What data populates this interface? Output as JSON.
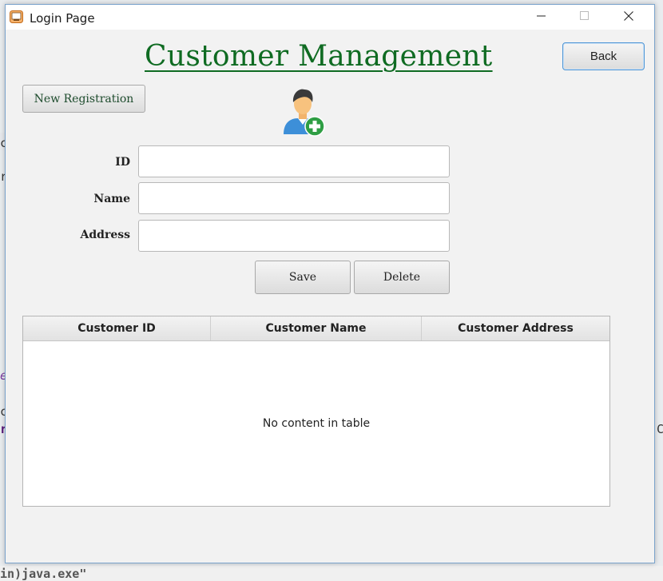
{
  "window": {
    "title": "Login Page",
    "controls": {
      "minimize": "minimize-icon",
      "maximize": "maximize-icon",
      "close": "close-icon"
    }
  },
  "header": {
    "title": "Customer Management",
    "back_label": "Back"
  },
  "new_registration_label": "New Registration",
  "form": {
    "fields": [
      {
        "label": "ID",
        "value": "",
        "placeholder": ""
      },
      {
        "label": "Name",
        "value": "",
        "placeholder": ""
      },
      {
        "label": "Address",
        "value": "",
        "placeholder": ""
      }
    ],
    "save_label": "Save",
    "delete_label": "Delete"
  },
  "table": {
    "columns": [
      "Customer ID",
      "Customer Name",
      "Customer Address"
    ],
    "rows": [],
    "placeholder": "No content in table"
  },
  "background": {
    "fragments": [
      "c",
      "r",
      "e",
      "c",
      "r",
      "C"
    ],
    "bottom_text": "in)java.exe\""
  },
  "colors": {
    "title_green": "#0f6b22",
    "focus_blue": "#4f96d6",
    "window_bg": "#f2f2f2"
  }
}
